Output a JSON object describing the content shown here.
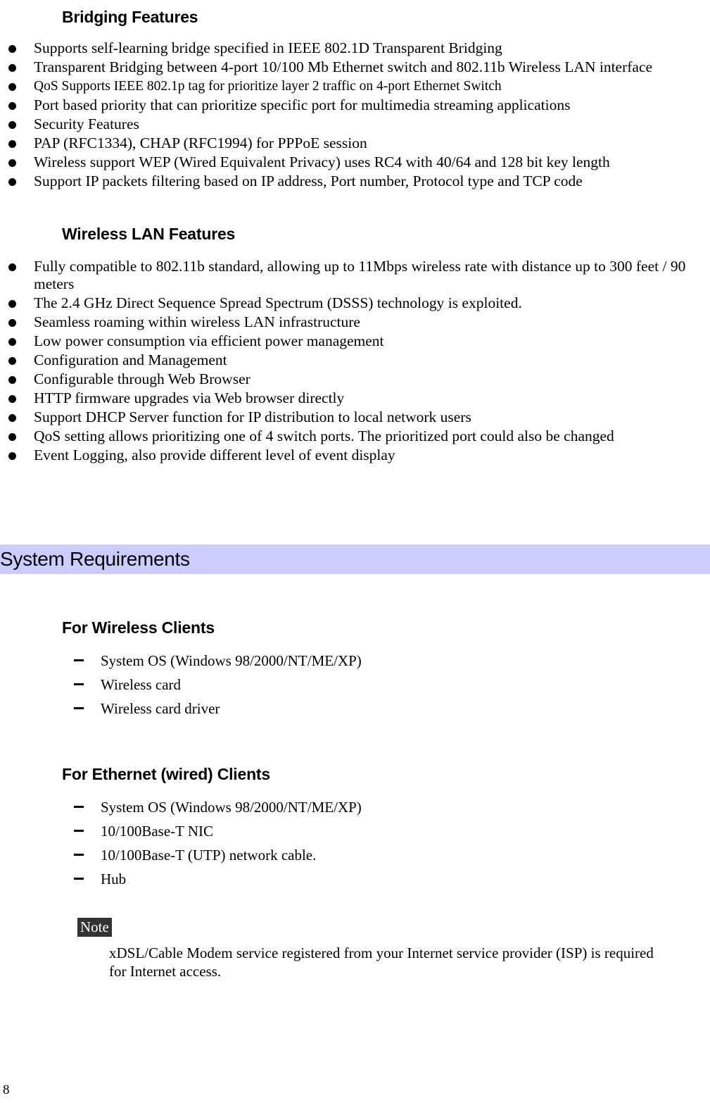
{
  "document": {
    "page_number": "8"
  },
  "bridging": {
    "heading": "Bridging Features",
    "items": [
      {
        "text": "Supports self-learning bridge specified in IEEE 802.1D Transparent Bridging",
        "small": false
      },
      {
        "text": "Transparent Bridging between 4-port 10/100 Mb Ethernet switch and 802.11b Wireless LAN interface",
        "small": false
      },
      {
        "text": "QoS Supports IEEE 802.1p tag for prioritize layer 2 traffic on 4-port Ethernet Switch",
        "small": true
      },
      {
        "text": "Port based priority that can prioritize specific port for multimedia streaming applications",
        "small": false
      },
      {
        "text": "Security Features",
        "small": false
      },
      {
        "text": "PAP (RFC1334), CHAP (RFC1994) for PPPoE session",
        "small": false
      },
      {
        "text": "Wireless support WEP (Wired Equivalent Privacy) uses RC4 with 40/64 and 128 bit key length",
        "small": false
      },
      {
        "text": "Support IP packets filtering based on IP address, Port number, Protocol type and TCP code",
        "small": false
      }
    ]
  },
  "wireless_lan": {
    "heading": "Wireless LAN Features",
    "items": [
      {
        "text": "Fully compatible to 802.11b standard, allowing up to 11Mbps wireless rate with distance up to 300 feet / 90 meters",
        "small": false
      },
      {
        "text": "The 2.4 GHz Direct Sequence Spread Spectrum (DSSS) technology is exploited.",
        "small": false
      },
      {
        "text": "Seamless roaming within wireless LAN infrastructure",
        "small": false
      },
      {
        "text": "Low power consumption via efficient power management",
        "small": false
      },
      {
        "text": "Configuration and Management",
        "small": false
      },
      {
        "text": "Configurable through Web Browser",
        "small": false
      },
      {
        "text": "HTTP firmware upgrades via Web browser directly",
        "small": false
      },
      {
        "text": "Support DHCP Server function for IP distribution to local network users",
        "small": false
      },
      {
        "text": "QoS setting allows prioritizing one of 4 switch ports. The prioritized port could also be changed",
        "small": false
      },
      {
        "text": "Event Logging, also provide different level of event display",
        "small": false
      }
    ]
  },
  "system_requirements": {
    "banner_title": "System Requirements",
    "banner_color": "#ccccff",
    "wireless_clients": {
      "heading": "For Wireless Clients",
      "items": [
        "System OS (Windows 98/2000/NT/ME/XP)",
        "Wireless card",
        "Wireless card driver"
      ]
    },
    "ethernet_clients": {
      "heading": "For Ethernet (wired) Clients",
      "items": [
        "System OS (Windows 98/2000/NT/ME/XP)",
        "10/100Base-T NIC",
        "10/100Base-T (UTP) network cable.",
        "Hub"
      ]
    },
    "note": {
      "label": "Note",
      "label_bg": "#333333",
      "body": "xDSL/Cable Modem service registered from your Internet service provider (ISP) is required for Internet access."
    }
  }
}
